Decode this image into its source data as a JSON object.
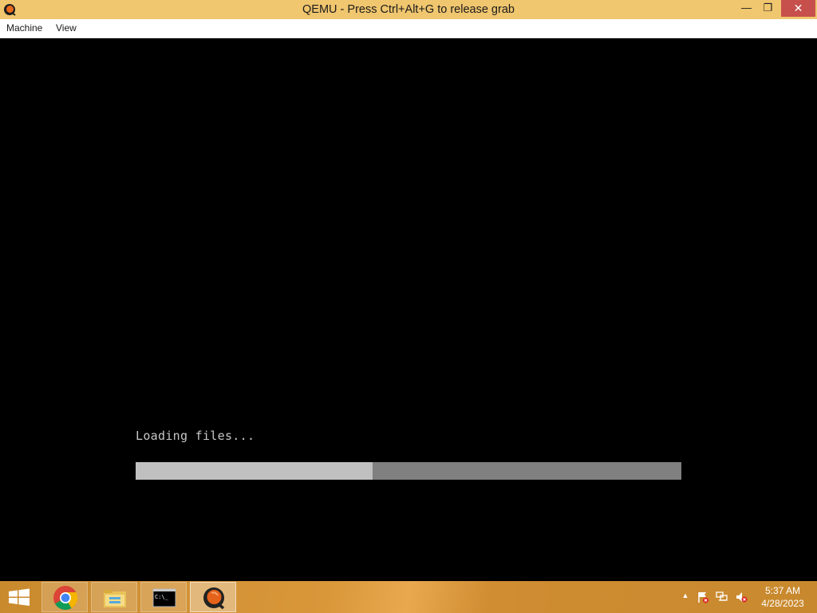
{
  "window": {
    "title": "QEMU - Press Ctrl+Alt+G to release grab",
    "minimize_glyph": "—",
    "restore_glyph": "❐",
    "close_glyph": "✕"
  },
  "menubar": {
    "items": [
      "Machine",
      "View"
    ]
  },
  "screen": {
    "loading_text": "Loading files...",
    "progress_fraction": 0.434,
    "progress_fill_color": "#c0c0c0",
    "progress_track_color": "#808080"
  },
  "taskbar": {
    "apps": [
      {
        "name": "chrome",
        "icon": "chrome-icon"
      },
      {
        "name": "file-explorer",
        "icon": "folder-icon"
      },
      {
        "name": "command-prompt",
        "icon": "cmd-icon",
        "glyph": "C:\\_"
      },
      {
        "name": "qemu",
        "icon": "qemu-icon",
        "active": true
      }
    ],
    "tray": {
      "show_hidden_glyph": "▲",
      "time": "5:37 AM",
      "date": "4/28/2023"
    }
  },
  "colors": {
    "titlebar": "#f0c66e",
    "close_button": "#c7504c",
    "taskbar": "#d9973a"
  }
}
